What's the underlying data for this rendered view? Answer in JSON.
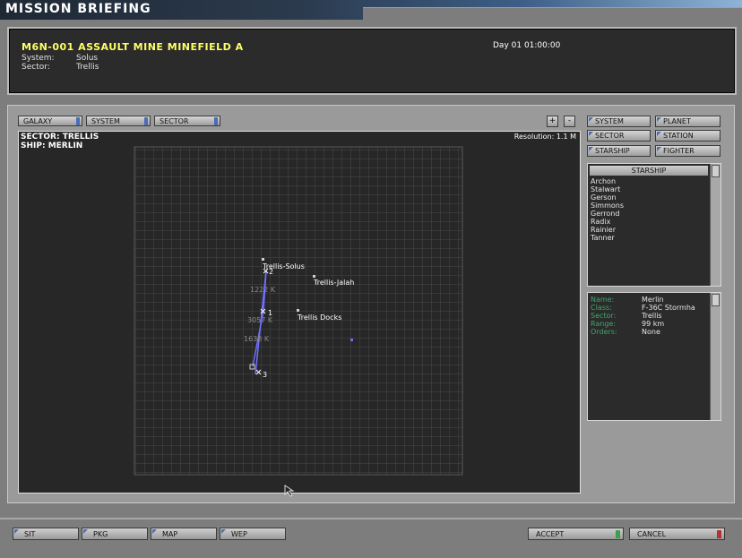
{
  "window": {
    "title": "MISSION BRIEFING"
  },
  "briefing": {
    "mission": "M6N-001  ASSAULT MINE MINEFIELD A",
    "system_label": "System:",
    "system_value": "Solus",
    "sector_label": "Sector:",
    "sector_value": "Trellis",
    "time": "Day 01 01:00:00"
  },
  "nav_tabs": [
    "GALAXY",
    "SYSTEM",
    "SECTOR"
  ],
  "zoom": {
    "in": "+",
    "out": "-"
  },
  "map": {
    "sector": "SECTOR: TRELLIS",
    "ship": "SHIP: MERLIN",
    "resolution": "Resolution: 1.1 M",
    "places": [
      "Trellis-Solus",
      "Trellis-Jalah",
      "Trellis Docks"
    ],
    "waypoints": [
      "1",
      "2",
      "3"
    ],
    "distances": [
      "1222 K",
      "3057 K",
      "1638 K"
    ]
  },
  "filters": {
    "system": "SYSTEM",
    "planet": "PLANET",
    "sector": "SECTOR",
    "station": "STATION",
    "starship": "STARSHIP",
    "fighter": "FIGHTER"
  },
  "starship_list": {
    "header": "STARSHIP",
    "items": [
      "Archon",
      "Stalwart",
      "Gerson",
      "Simmons",
      "Gerrond",
      "Radix",
      "Rainier",
      "Tanner"
    ]
  },
  "details": {
    "name_label": "Name:",
    "name_value": "Merlin",
    "class_label": "Class:",
    "class_value": "F-36C Stormha",
    "sector_label": "Sector:",
    "sector_value": "Trellis",
    "range_label": "Range:",
    "range_value": "99 km",
    "orders_label": "Orders:",
    "orders_value": "None"
  },
  "bottom_tabs": [
    "SIT",
    "PKG",
    "MAP",
    "WEP"
  ],
  "actions": {
    "accept": "ACCEPT",
    "cancel": "CANCEL"
  },
  "colors": {
    "accent": "#4a6db5",
    "title_text": "#ffff66",
    "route": "#6f6fff",
    "detail_label": "#3fa66a"
  }
}
